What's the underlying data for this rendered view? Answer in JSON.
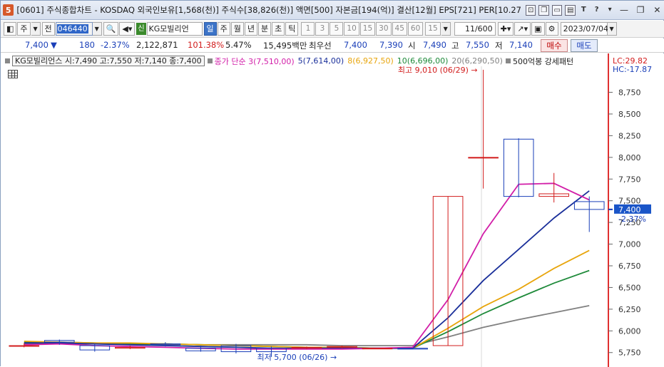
{
  "window": {
    "badge": "5",
    "title": "[0601] 주식종합차트 - KOSDAQ 외국인보유[1,568(천)] 주식수[38,826(천)] 액면[500] 자본금[194(억)] 결산[12월] EPS[721] PER[10.27"
  },
  "toolbar": {
    "mode_primary": "주",
    "mode_secondary": "전",
    "stock_code": "046440",
    "sin_badge": "신",
    "stock_name": "KG모빌리언",
    "periods": [
      "일",
      "주",
      "월",
      "년",
      "분",
      "초",
      "틱"
    ],
    "active_period": "일",
    "intervals": [
      "1",
      "3",
      "5",
      "10",
      "15",
      "30",
      "45",
      "60"
    ],
    "interval_value": "15",
    "pager": "11/600",
    "date": "2023/07/04"
  },
  "quote": {
    "price": "7,400",
    "change": "180",
    "change_pct": "-2.37%",
    "volume": "2,122,871",
    "volume_ratio": "101.38%",
    "turnover": "5.47%",
    "amount": "15,495백만",
    "best_bid_label": "최우선",
    "best_ask": "7,400",
    "best_bid": "7,390",
    "open_label": "시",
    "open": "7,490",
    "high_label": "고",
    "high": "7,550",
    "low_label": "저",
    "low": "7,140",
    "buy_label": "매수",
    "sell_label": "매도"
  },
  "legend": {
    "series_info": "KG모빌리언스 시:7,490 고:7,550 저:7,140 종:7,400",
    "ma_prefix": "종가 단순 3(7,510,00)",
    "ma5": "5(7,614,00)",
    "ma8": "8(6,927,50)",
    "ma10": "10(6,696,00)",
    "ma20": "20(6,290,50)",
    "pattern": "500억봉 강세패턴"
  },
  "right_axis": {
    "lc": "LC:29.82",
    "hc": "HC:-17.87",
    "current_price": "7,400",
    "current_pct": "-2.37%"
  },
  "annotations": {
    "high_note": "최고 9,010 (06/29)",
    "low_note": "최저 5,700 (06/26)"
  },
  "colors": {
    "up": "#d21c1c",
    "down": "#1a3fb8",
    "ma3": "#d21ea8",
    "ma5": "#1a2f9a",
    "ma8": "#e8a50c",
    "ma10": "#1e8a3a",
    "ma20": "#808080"
  },
  "chart_data": {
    "type": "line",
    "title": "",
    "y_unit": "KRW",
    "ylim": [
      5600,
      9050
    ],
    "y_ticks": [
      5750,
      6000,
      6250,
      6500,
      6750,
      7000,
      7250,
      7500,
      7750,
      8000,
      8250,
      8500,
      8750
    ],
    "y_tick_labels": [
      "5,750",
      "6,000",
      "6,250",
      "6,500",
      "6,750",
      "7,000",
      "7,250",
      "7,500",
      "7,750",
      "8,000",
      "8,250",
      "8,500",
      "8,750"
    ],
    "candles": [
      {
        "open": 5830,
        "high": 5860,
        "low": 5810,
        "close": 5830
      },
      {
        "open": 5890,
        "high": 5900,
        "low": 5840,
        "close": 5870
      },
      {
        "open": 5830,
        "high": 5850,
        "low": 5760,
        "close": 5780
      },
      {
        "open": 5800,
        "high": 5830,
        "low": 5790,
        "close": 5810
      },
      {
        "open": 5850,
        "high": 5870,
        "low": 5820,
        "close": 5840
      },
      {
        "open": 5800,
        "high": 5830,
        "low": 5760,
        "close": 5770
      },
      {
        "open": 5830,
        "high": 5850,
        "low": 5740,
        "close": 5760
      },
      {
        "open": 5800,
        "high": 5820,
        "low": 5700,
        "close": 5760
      },
      {
        "open": 5800,
        "high": 5820,
        "low": 5790,
        "close": 5810
      },
      {
        "open": 5810,
        "high": 5830,
        "low": 5800,
        "close": 5820
      },
      {
        "open": 5800,
        "high": 5800,
        "low": 5790,
        "close": 5800
      },
      {
        "open": 5800,
        "high": 5800,
        "low": 5790,
        "close": 5790
      },
      {
        "open": 5830,
        "high": 7550,
        "low": 5830,
        "close": 7550
      },
      {
        "open": 8000,
        "high": 9010,
        "low": 7640,
        "close": 8000
      },
      {
        "open": 8210,
        "high": 8220,
        "low": 7540,
        "close": 7550
      },
      {
        "open": 7550,
        "high": 7820,
        "low": 7480,
        "close": 7580
      },
      {
        "open": 7490,
        "high": 7550,
        "low": 7140,
        "close": 7400
      }
    ],
    "series": [
      {
        "name": "3",
        "values": [
          5840,
          5850,
          5830,
          5820,
          5810,
          5800,
          5790,
          5790,
          5790,
          5790,
          5800,
          5810,
          6360,
          7120,
          7690,
          7700,
          7510
        ]
      },
      {
        "name": "5",
        "values": [
          5860,
          5860,
          5850,
          5840,
          5830,
          5820,
          5810,
          5800,
          5800,
          5800,
          5800,
          5800,
          6150,
          6580,
          6940,
          7300,
          7614
        ]
      },
      {
        "name": "8",
        "values": [
          5880,
          5870,
          5860,
          5860,
          5850,
          5840,
          5830,
          5820,
          5810,
          5810,
          5800,
          5800,
          6030,
          6280,
          6480,
          6720,
          6927.5
        ]
      },
      {
        "name": "10",
        "values": [
          5870,
          5870,
          5860,
          5850,
          5850,
          5840,
          5830,
          5820,
          5810,
          5810,
          5800,
          5800,
          5990,
          6200,
          6380,
          6550,
          6696
        ]
      },
      {
        "name": "20",
        "values": [
          5850,
          5850,
          5850,
          5850,
          5850,
          5840,
          5840,
          5840,
          5840,
          5830,
          5830,
          5830,
          5930,
          6040,
          6130,
          6210,
          6290.5
        ]
      }
    ]
  }
}
